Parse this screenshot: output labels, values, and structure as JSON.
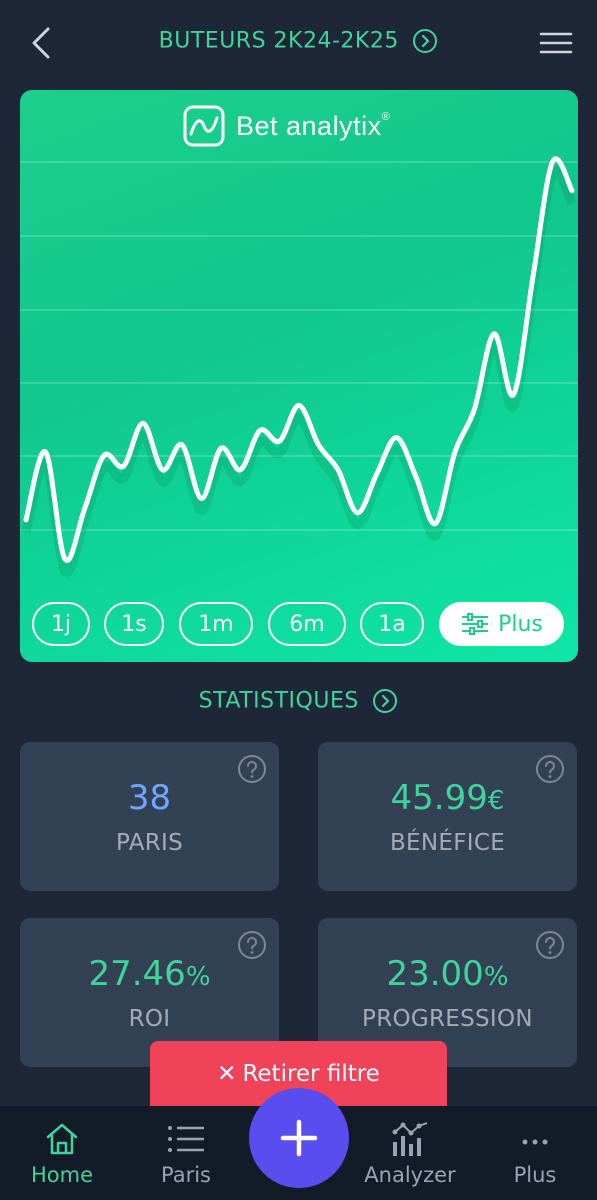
{
  "header": {
    "title": "BUTEURS 2K24-2K25"
  },
  "chart_card": {
    "brand": "Bet analytix",
    "brand_mark": "®",
    "range_buttons": [
      "1j",
      "1s",
      "1m",
      "6m",
      "1a"
    ],
    "more_label": "Plus"
  },
  "chart_data": {
    "type": "line",
    "title": "",
    "xlabel": "",
    "ylabel": "",
    "grid": true,
    "x": [
      1,
      2,
      3,
      4,
      5,
      6,
      7,
      8,
      9,
      10,
      11,
      12,
      13,
      14,
      15,
      16,
      17,
      18,
      19,
      20,
      21,
      22,
      23,
      24,
      25,
      26,
      27,
      28,
      29
    ],
    "values": [
      -2.0,
      7.5,
      -7.5,
      -0.5,
      7.0,
      5.5,
      11.5,
      5.0,
      8.5,
      1.0,
      8.0,
      5.0,
      10.5,
      9.0,
      14.0,
      8.5,
      5.0,
      -1.0,
      4.5,
      9.5,
      4.0,
      -2.5,
      7.5,
      13.5,
      24.0,
      15.5,
      32.0,
      48.0,
      44.0
    ],
    "ylim": [
      -9,
      48
    ],
    "line_color": "#ffffff",
    "background": "#1ccf8c"
  },
  "stats": {
    "title": "STATISTIQUES",
    "cards": [
      {
        "value": "38",
        "unit": "",
        "label": "PARIS",
        "color": "#6ea8fe"
      },
      {
        "value": "45.99",
        "unit": "€",
        "label": "BÉNÉFICE",
        "color": "#3fd59a"
      },
      {
        "value": "27.46",
        "unit": "%",
        "label": "ROI",
        "color": "#3fd59a"
      },
      {
        "value": "23.00",
        "unit": "%",
        "label": "PROGRESSION",
        "color": "#3fd59a"
      }
    ]
  },
  "toast": {
    "label": "Retirer filtre",
    "icon": "close-icon"
  },
  "nav": {
    "items": [
      {
        "label": "Home",
        "icon": "home-icon",
        "active": true
      },
      {
        "label": "Paris",
        "icon": "list-icon",
        "active": false
      },
      {
        "label": "Analyzer",
        "icon": "analyzer-icon",
        "active": false
      },
      {
        "label": "Plus",
        "icon": "more-icon",
        "active": false
      }
    ],
    "fab_icon": "plus-icon"
  },
  "colors": {
    "accent": "#3fd59a",
    "background": "#1e2738",
    "card": "#334155",
    "danger": "#f0435a",
    "fab": "#5a4df0"
  }
}
